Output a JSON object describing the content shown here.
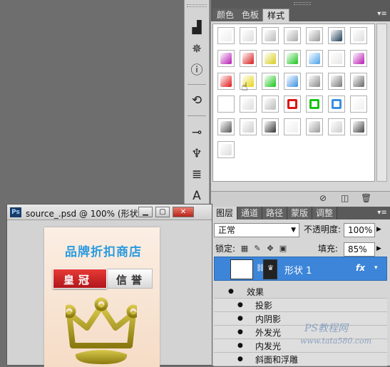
{
  "styles_panel": {
    "tabs": [
      "颜色",
      "色板",
      "样式"
    ],
    "active_tab": "样式",
    "footer_icons": [
      "no-icon",
      "new-icon",
      "trash-icon"
    ]
  },
  "tool_icons": [
    "histogram-icon",
    "navigator-icon",
    "info-icon",
    "history-icon",
    "brush-presets-icon",
    "clone-source-icon",
    "actions-icon",
    "character-icon"
  ],
  "layers_panel": {
    "tabs": [
      "图层",
      "通道",
      "路径",
      "蒙版",
      "调整"
    ],
    "active_tab": "图层",
    "blend_mode": "正常",
    "opacity_label": "不透明度:",
    "opacity_value": "100%",
    "lock_label": "锁定:",
    "fill_label": "填充:",
    "fill_value": "85%",
    "layer_name": "形状 1",
    "fx_label": "fx",
    "effects_label": "效果",
    "effects": [
      "投影",
      "内阴影",
      "外发光",
      "内发光",
      "斜面和浮雕"
    ]
  },
  "document": {
    "title": "source_.psd @ 100% (形状...",
    "ps_label": "Ps",
    "canvas_title": "品牌折扣商店",
    "banner_left": "皇冠",
    "banner_right": "信誉"
  },
  "watermark": {
    "line1": "PS教程网",
    "line2": "www.tata580.com"
  },
  "colors": {
    "accent_blue": "#3c85d9",
    "brand_title": "#2a9be0",
    "banner_red": "#e63a35"
  }
}
